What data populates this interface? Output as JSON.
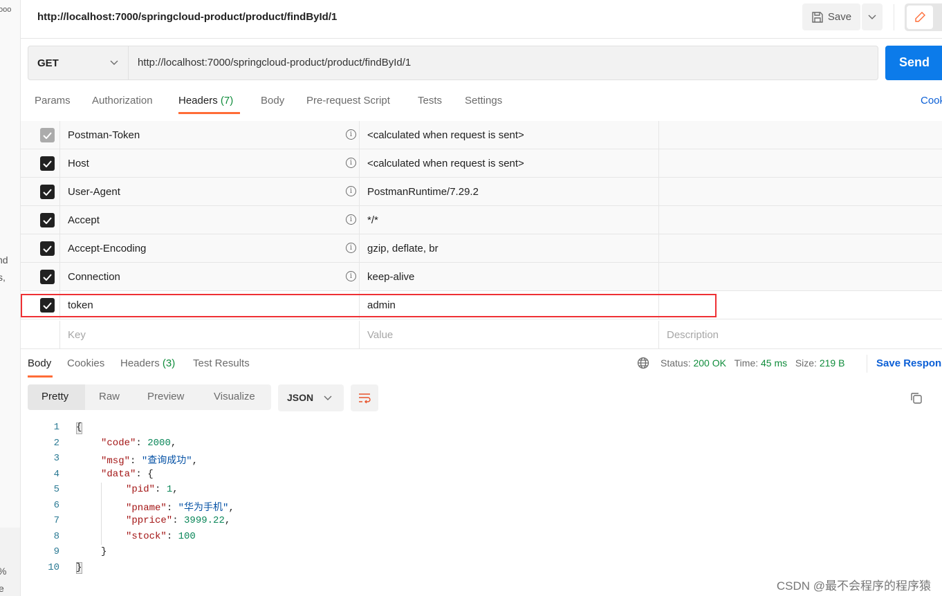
{
  "sidebar": {
    "fragments": [
      "ooo",
      "nd",
      "s,",
      "%",
      "e"
    ]
  },
  "header": {
    "title": "http://localhost:7000/springcloud-product/product/findById/1",
    "save_label": "Save"
  },
  "request": {
    "method": "GET",
    "url": "http://localhost:7000/springcloud-product/product/findById/1",
    "send_label": "Send"
  },
  "tabs": [
    {
      "label": "Params"
    },
    {
      "label": "Authorization"
    },
    {
      "label": "Headers",
      "count": "(7)"
    },
    {
      "label": "Body"
    },
    {
      "label": "Pre-request Script"
    },
    {
      "label": "Tests"
    },
    {
      "label": "Settings"
    }
  ],
  "cookies_link": "Cookies",
  "headers": [
    {
      "key": "Postman-Token",
      "value": "<calculated when request is sent>",
      "checked": true,
      "disabled": true
    },
    {
      "key": "Host",
      "value": "<calculated when request is sent>",
      "checked": true
    },
    {
      "key": "User-Agent",
      "value": "PostmanRuntime/7.29.2",
      "checked": true
    },
    {
      "key": "Accept",
      "value": "*/*",
      "checked": true
    },
    {
      "key": "Accept-Encoding",
      "value": "gzip, deflate, br",
      "checked": true
    },
    {
      "key": "Connection",
      "value": "keep-alive",
      "checked": true
    },
    {
      "key": "token",
      "value": "admin",
      "checked": true
    }
  ],
  "new_row": {
    "key_placeholder": "Key",
    "value_placeholder": "Value",
    "description_placeholder": "Description"
  },
  "response": {
    "tabs": [
      {
        "label": "Body"
      },
      {
        "label": "Cookies"
      },
      {
        "label": "Headers",
        "count": "(3)"
      },
      {
        "label": "Test Results"
      }
    ],
    "status_label": "Status:",
    "status": "200 OK",
    "time_label": "Time:",
    "time": "45 ms",
    "size_label": "Size:",
    "size": "219 B",
    "save_label": "Save Response",
    "views": [
      "Pretty",
      "Raw",
      "Preview",
      "Visualize"
    ],
    "format": "JSON",
    "lines": [
      "1",
      "2",
      "3",
      "4",
      "5",
      "6",
      "7",
      "8",
      "9",
      "10"
    ],
    "body": {
      "code": "2000",
      "msg": "\"查询成功\"",
      "pid": "1",
      "pname": "\"华为手机\"",
      "pprice": "3999.22",
      "stock": "100"
    }
  },
  "watermark": "CSDN @最不会程序的程序猿",
  "colors": {
    "accent": "#ff6c37",
    "send": "#0c7bea",
    "status_ok": "#0f8c3b",
    "highlight": "#ee3034"
  }
}
